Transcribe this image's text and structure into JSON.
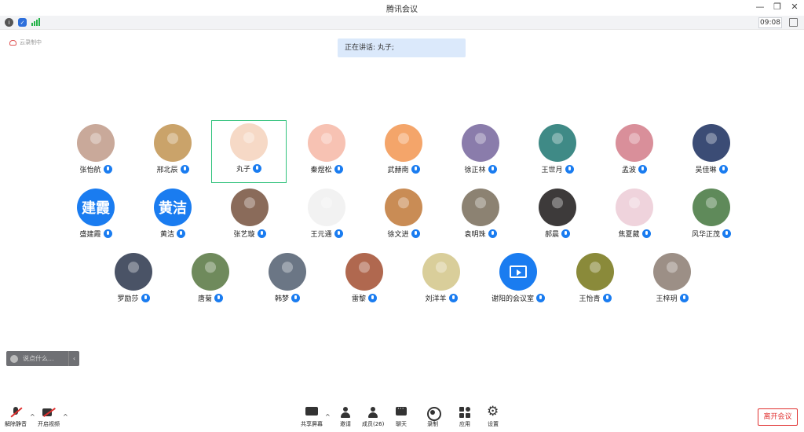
{
  "window": {
    "title": "腾讯会议",
    "minimize": "—",
    "restore": "❐",
    "close": "✕"
  },
  "toolbar": {
    "clock": "09:08",
    "info_glyph": "i",
    "shield_glyph": "✓"
  },
  "recording_label": "云录制中",
  "speaking": {
    "text": "正在讲话: 丸子;"
  },
  "participants": [
    {
      "name": "张怡航",
      "avatar": "photo",
      "color": "#c9a99a"
    },
    {
      "name": "邢北辰",
      "avatar": "photo",
      "color": "#caa36a"
    },
    {
      "name": "丸子",
      "avatar": "photo",
      "color": "#f6d9c6",
      "active": true
    },
    {
      "name": "秦煜松",
      "avatar": "photo",
      "color": "#f7c2b3"
    },
    {
      "name": "武赫南",
      "avatar": "photo",
      "color": "#f4a56a"
    },
    {
      "name": "徐正林",
      "avatar": "photo",
      "color": "#8a7cab"
    },
    {
      "name": "王世月",
      "avatar": "photo",
      "color": "#3f8a86"
    },
    {
      "name": "孟波",
      "avatar": "photo",
      "color": "#d98f9a"
    },
    {
      "name": "吴佳琳",
      "avatar": "photo",
      "color": "#3b4c75"
    },
    {
      "name": "盛建霞",
      "avatar": "text",
      "avatar_text": "建霞",
      "color": "#1a7cf0"
    },
    {
      "name": "黄洁",
      "avatar": "text",
      "avatar_text": "黄洁",
      "color": "#1a7cf0"
    },
    {
      "name": "张艺璇",
      "avatar": "photo",
      "color": "#8a6b5a"
    },
    {
      "name": "王元通",
      "avatar": "photo",
      "color": "#f2f2f2"
    },
    {
      "name": "徐文进",
      "avatar": "photo",
      "color": "#c98c55"
    },
    {
      "name": "袁明珠",
      "avatar": "photo",
      "color": "#8c8272"
    },
    {
      "name": "郝晨",
      "avatar": "photo",
      "color": "#3d3a3a"
    },
    {
      "name": "焦夏葳",
      "avatar": "photo",
      "color": "#efd3dc"
    },
    {
      "name": "风华正茂",
      "avatar": "photo",
      "color": "#5f8a5a"
    },
    {
      "name": "罗励莎",
      "avatar": "photo",
      "color": "#4a5366"
    },
    {
      "name": "唐菊",
      "avatar": "photo",
      "color": "#6f8a5c"
    },
    {
      "name": "韩梦",
      "avatar": "photo",
      "color": "#6b7685"
    },
    {
      "name": "雷黎",
      "avatar": "photo",
      "color": "#b0684f"
    },
    {
      "name": "刘洋羊",
      "avatar": "photo",
      "color": "#d9ce9a"
    },
    {
      "name": "谢阳的会议室",
      "avatar": "room",
      "color": "#1a7cf0"
    },
    {
      "name": "王怡青",
      "avatar": "photo",
      "color": "#8a8a3a"
    },
    {
      "name": "王梓玥",
      "avatar": "photo",
      "color": "#9c8f86"
    }
  ],
  "chat": {
    "placeholder": "说点什么...",
    "collapse": "‹"
  },
  "bottom": {
    "unmute": "解除静音",
    "start_video": "开启视频",
    "share_screen": "共享屏幕",
    "invite": "邀请",
    "members": "成员(26)",
    "chat": "聊天",
    "record": "录制",
    "apps": "应用",
    "settings": "设置",
    "leave": "离开会议",
    "caret": "^"
  }
}
